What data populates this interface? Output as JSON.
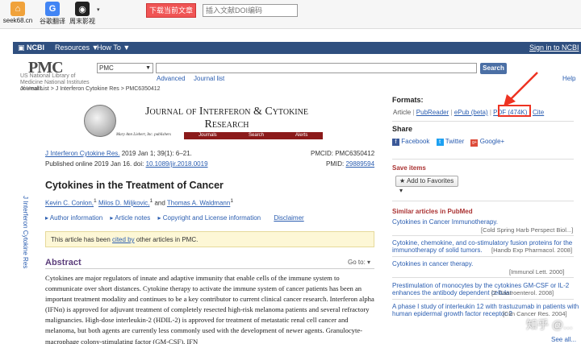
{
  "browser_bar": {
    "bookmarks": [
      {
        "label": "seek68.cn",
        "icon": "house-icon",
        "glyph": "⌂"
      },
      {
        "label": "谷歌翻译",
        "icon": "google-icon",
        "glyph": "G"
      },
      {
        "label": "周末影视",
        "icon": "film-icon",
        "glyph": "◉"
      }
    ],
    "download_button": "下载当前文章",
    "doi_placeholder": "插入文献DOI编码"
  },
  "ncbi_bar": {
    "brand": "NCBI",
    "resources": "Resources ▼",
    "howto": "How To ▼",
    "signin": "Sign in to NCBI"
  },
  "header": {
    "logo": "PMC",
    "nlm_text": "US National Library of Medicine National Institutes of Health",
    "db_selected": "PMC",
    "search_button": "Search",
    "advanced": "Advanced",
    "journal_list": "Journal list",
    "help": "Help"
  },
  "breadcrumb": "Journal List > J Interferon Cytokine Res > PMC6350412",
  "journal_banner": {
    "title_line1": "Journal of Interferon & Cytokine",
    "title_line2": "Research",
    "publisher_line": "Mary Ann Liebert, Inc. publishers",
    "nav": [
      "Journals",
      "Search",
      "Alerts"
    ]
  },
  "side_label": "J Interferon Cytokine Res",
  "article": {
    "journal_link": "J Interferon Cytokine Res.",
    "issue": " 2019 Jan 1; 39(1): 6–21.",
    "published": "Published online 2019 Jan 16. doi:",
    "doi": "10.1089/jir.2018.0019",
    "pmcid": "PMCID: PMC6350412",
    "pmid_label": "PMID: ",
    "pmid": "29889594",
    "title": "Cytokines in the Treatment of Cancer",
    "authors": [
      {
        "name": "Kevin C. Conlon,",
        "sup": "1"
      },
      {
        "name": "Milos D. Miljkovic,",
        "sup": "1"
      },
      {
        "name": "Thomas A. Waldmann",
        "sup": "1"
      }
    ],
    "and_word": "and",
    "info_links": [
      "Author information",
      "Article notes",
      "Copyright and License information"
    ],
    "disclaimer": "Disclaimer",
    "cited_prefix": "This article has been ",
    "cited_link": "cited by",
    "cited_suffix": " other articles in PMC.",
    "abstract_heading": "Abstract",
    "goto": "Go to: ▾",
    "abstract_text": "Cytokines are major regulators of innate and adaptive immunity that enable cells of the immune system to communicate over short distances. Cytokine therapy to activate the immune system of cancer patients has been an important treatment modality and continues to be a key contributor to current clinical cancer research. Interferon alpha (IFNα) is approved for adjuvant treatment of completely resected high-risk melanoma patients and several refractory malignancies. High-dose interleukin-2 (HDIL-2) is approved for treatment of metastatic renal cell cancer and melanoma, but both agents are currently less commonly used with the development of newer agents. Granulocyte-macrophage colony-stimulating factor (GM-CSF), IFN"
  },
  "sidebar": {
    "formats_heading": "Formats:",
    "formats": [
      "Article",
      "PubReader",
      "ePub (beta)",
      "PDF (474K)",
      "Cite"
    ],
    "share_heading": "Share",
    "share": [
      {
        "label": "Facebook",
        "icon": "facebook-icon",
        "glyph": "f",
        "color": "#3b5998"
      },
      {
        "label": "Twitter",
        "icon": "twitter-icon",
        "glyph": "t",
        "color": "#1da1f2"
      },
      {
        "label": "Google+",
        "icon": "google-plus-icon",
        "glyph": "g+",
        "color": "#dd4b39"
      }
    ],
    "save_heading": "Save items",
    "save_button": "Add to Favorites",
    "similar_heading": "Similar articles in PubMed",
    "similar": [
      {
        "title": "Cytokines in Cancer Immunotherapy.",
        "source": "[Cold Spring Harb Perspect Biol...]"
      },
      {
        "title": "Cytokine, chemokine, and co-stimulatory fusion proteins for the",
        "title2": "immunotherapy of solid tumors.",
        "source": "[Handb Exp Pharmacol. 2008]"
      },
      {
        "title": "Cytokines in cancer therapy.",
        "source": "[Immunol Lett. 2000]"
      },
      {
        "title": "Prestimulation of monocytes by the cytokines GM-CSF or IL-2",
        "title2": "enhances the antibody dependent cellular",
        "source": "[Z Gastroenterol. 2008]"
      },
      {
        "title": "A phase I study of interleukin 12 with trastuzumab in patients with",
        "title2": "human epidermal growth factor receptor-2",
        "source": "[Clin Cancer Res. 2004]"
      }
    ],
    "see_all": "See all..."
  },
  "watermark": "知乎 @..."
}
